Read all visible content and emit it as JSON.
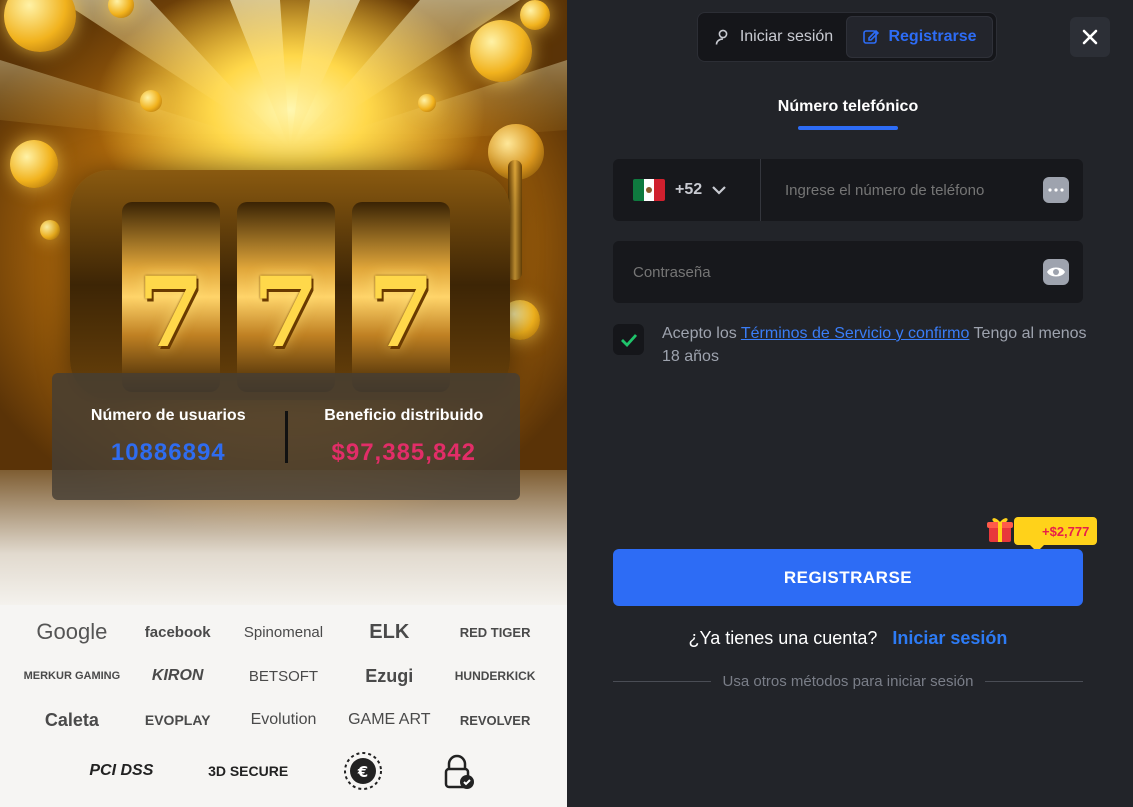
{
  "auth_tabs": {
    "login_label": "Iniciar sesión",
    "register_label": "Registrarse",
    "active": "register"
  },
  "close_icon": "close-icon",
  "method_tab": {
    "label": "Número telefónico"
  },
  "phone": {
    "country_code": "+52",
    "country_flag": "mexico-flag",
    "placeholder": "Ingrese el número de teléfono"
  },
  "password": {
    "placeholder": "Contraseña"
  },
  "terms": {
    "prefix": "Acepto los",
    "link": "Términos de Servicio y confirmo",
    "suffix": "Tengo al menos 18 años",
    "checked": true
  },
  "bonus": {
    "amount": "+$2,777"
  },
  "register_button": {
    "label": "REGISTRARSE"
  },
  "login_prompt": {
    "text": "¿Ya tienes una cuenta?",
    "link": "Iniciar sesión"
  },
  "other_methods": {
    "text": "Usa otros métodos para iniciar sesión"
  },
  "stats": {
    "users_label": "Número de usuarios",
    "users_value": "10886894",
    "benefit_label": "Beneficio distribuido",
    "benefit_value": "$97,385,842"
  },
  "slot": {
    "symbols": [
      "7",
      "7",
      "7"
    ]
  },
  "partners": [
    "Google",
    "facebook",
    "Spinomenal",
    "ELK",
    "RED TIGER",
    "MERKUR GAMING",
    "KIRON",
    "BETSOFT",
    "Ezugi",
    "HUNDERKICK",
    "Caleta",
    "EVOPLAY",
    "Evolution",
    "GAME ART",
    "REVOLVER"
  ],
  "security": {
    "pci": "PCI DSS",
    "three_d": "3D SECURE"
  },
  "colors": {
    "accent": "#2d6cf5",
    "panel": "#222429",
    "field": "#17181c",
    "users_value": "#2f6cf0",
    "benefit_value": "#e22d68",
    "bonus_bg": "#ffd21a"
  }
}
